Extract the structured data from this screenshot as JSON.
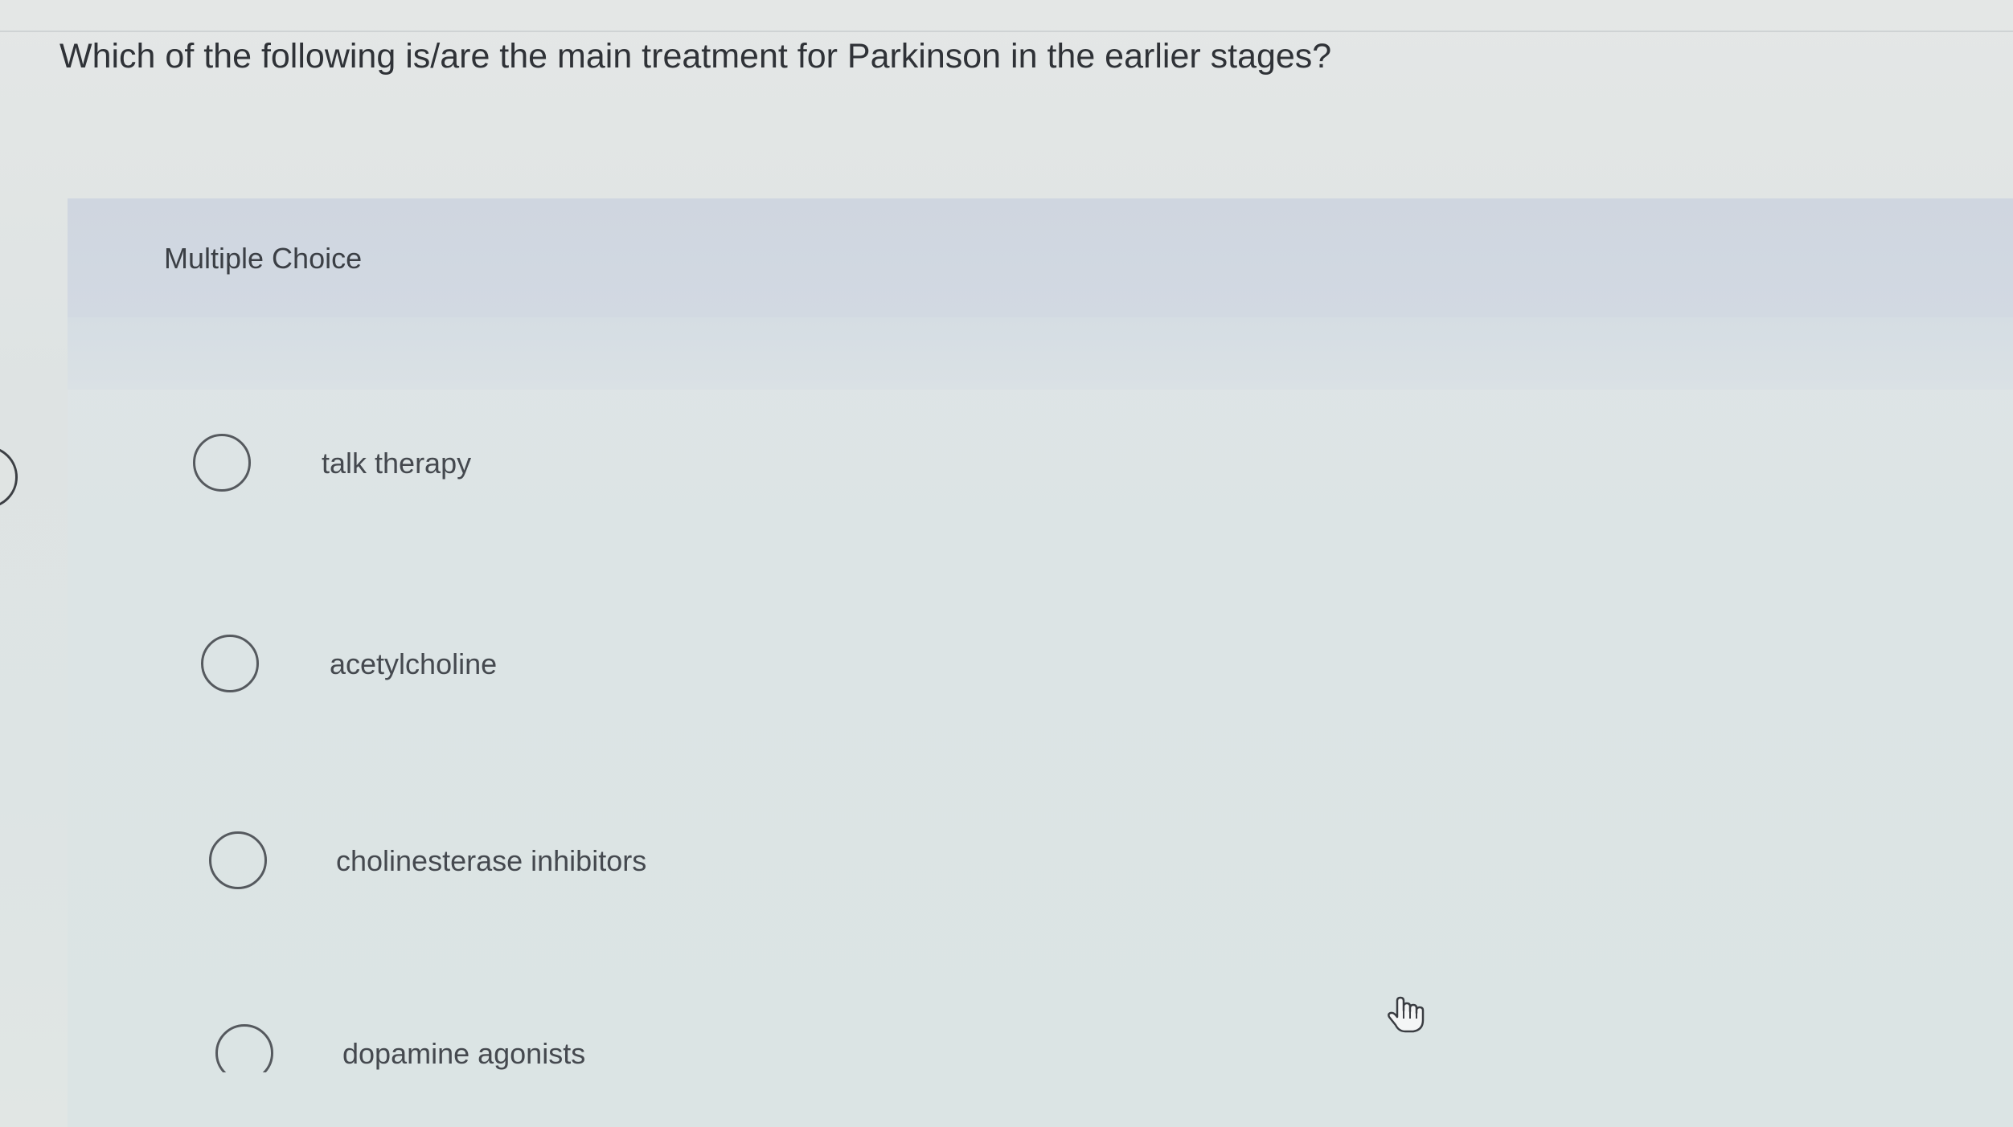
{
  "question": {
    "text": "Which of the following is/are the main treatment for Parkinson in the earlier stages?"
  },
  "panel": {
    "label": "Multiple Choice"
  },
  "choices": [
    {
      "label": "talk therapy"
    },
    {
      "label": "acetylcholine"
    },
    {
      "label": "cholinesterase inhibitors"
    },
    {
      "label": "dopamine agonists"
    }
  ],
  "icons": {
    "cursor": "hand-pointer-icon",
    "radio": "radio-circle-icon",
    "side_tab": "chevron-tab-icon"
  },
  "colors": {
    "header_band": "#cfd6e0",
    "background": "#dee3e3",
    "text": "#2f3237"
  }
}
